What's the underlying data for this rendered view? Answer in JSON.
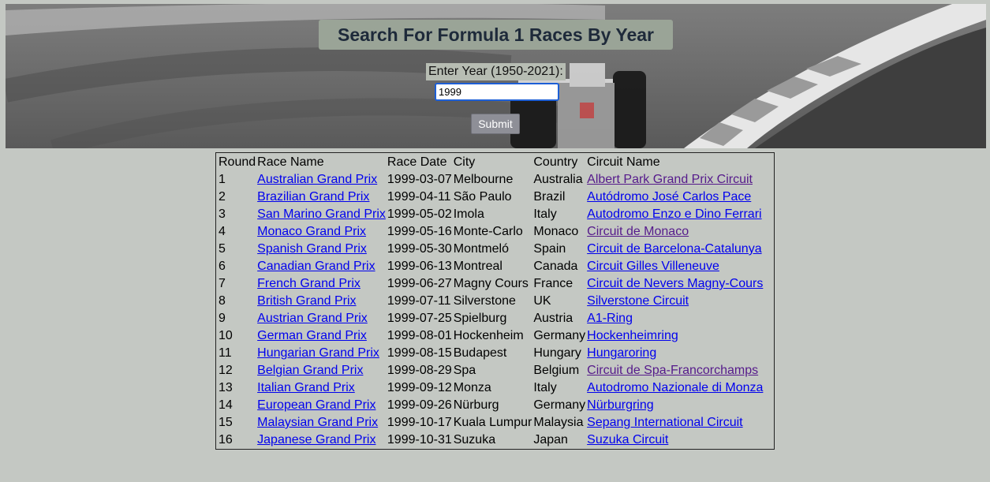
{
  "header": {
    "title": "Search For Formula 1 Races By Year",
    "year_label": "Enter Year (1950-2021):",
    "year_value": "1999",
    "submit_label": "Submit"
  },
  "table": {
    "columns": [
      "Round",
      "Race Name",
      "Race Date",
      "City",
      "Country",
      "Circuit Name"
    ],
    "rows": [
      {
        "round": "1",
        "race": "Australian Grand Prix",
        "date": "1999-03-07",
        "city": "Melbourne",
        "country": "Australia",
        "circuit": "Albert Park Grand Prix Circuit",
        "circuit_visited": true
      },
      {
        "round": "2",
        "race": "Brazilian Grand Prix",
        "date": "1999-04-11",
        "city": "São Paulo",
        "country": "Brazil",
        "circuit": "Autódromo José Carlos Pace",
        "circuit_visited": false
      },
      {
        "round": "3",
        "race": "San Marino Grand Prix",
        "date": "1999-05-02",
        "city": "Imola",
        "country": "Italy",
        "circuit": "Autodromo Enzo e Dino Ferrari",
        "circuit_visited": false
      },
      {
        "round": "4",
        "race": "Monaco Grand Prix",
        "date": "1999-05-16",
        "city": "Monte-Carlo",
        "country": "Monaco",
        "circuit": "Circuit de Monaco",
        "circuit_visited": true
      },
      {
        "round": "5",
        "race": "Spanish Grand Prix",
        "date": "1999-05-30",
        "city": "Montmeló",
        "country": "Spain",
        "circuit": "Circuit de Barcelona-Catalunya",
        "circuit_visited": false
      },
      {
        "round": "6",
        "race": "Canadian Grand Prix",
        "date": "1999-06-13",
        "city": "Montreal",
        "country": "Canada",
        "circuit": "Circuit Gilles Villeneuve",
        "circuit_visited": false
      },
      {
        "round": "7",
        "race": "French Grand Prix",
        "date": "1999-06-27",
        "city": "Magny Cours",
        "country": "France",
        "circuit": "Circuit de Nevers Magny-Cours",
        "circuit_visited": false
      },
      {
        "round": "8",
        "race": "British Grand Prix",
        "date": "1999-07-11",
        "city": "Silverstone",
        "country": "UK",
        "circuit": "Silverstone Circuit",
        "circuit_visited": false
      },
      {
        "round": "9",
        "race": "Austrian Grand Prix",
        "date": "1999-07-25",
        "city": "Spielburg",
        "country": "Austria",
        "circuit": "A1-Ring",
        "circuit_visited": false
      },
      {
        "round": "10",
        "race": "German Grand Prix",
        "date": "1999-08-01",
        "city": "Hockenheim",
        "country": "Germany",
        "circuit": "Hockenheimring",
        "circuit_visited": false
      },
      {
        "round": "11",
        "race": "Hungarian Grand Prix",
        "date": "1999-08-15",
        "city": "Budapest",
        "country": "Hungary",
        "circuit": "Hungaroring",
        "circuit_visited": false
      },
      {
        "round": "12",
        "race": "Belgian Grand Prix",
        "date": "1999-08-29",
        "city": "Spa",
        "country": "Belgium",
        "circuit": "Circuit de Spa-Francorchamps",
        "circuit_visited": true
      },
      {
        "round": "13",
        "race": "Italian Grand Prix",
        "date": "1999-09-12",
        "city": "Monza",
        "country": "Italy",
        "circuit": "Autodromo Nazionale di Monza",
        "circuit_visited": false
      },
      {
        "round": "14",
        "race": "European Grand Prix",
        "date": "1999-09-26",
        "city": "Nürburg",
        "country": "Germany",
        "circuit": "Nürburgring",
        "circuit_visited": false
      },
      {
        "round": "15",
        "race": "Malaysian Grand Prix",
        "date": "1999-10-17",
        "city": "Kuala Lumpur",
        "country": "Malaysia",
        "circuit": "Sepang International Circuit",
        "circuit_visited": false
      },
      {
        "round": "16",
        "race": "Japanese Grand Prix",
        "date": "1999-10-31",
        "city": "Suzuka",
        "country": "Japan",
        "circuit": "Suzuka Circuit",
        "circuit_visited": false
      }
    ]
  },
  "colors": {
    "page_background": "#c4c8c3",
    "title_background": "#9aa497",
    "title_text": "#1e2a3a",
    "link": "#0000ee",
    "visited_link": "#551a8b",
    "submit_button": "#8e8f97"
  }
}
